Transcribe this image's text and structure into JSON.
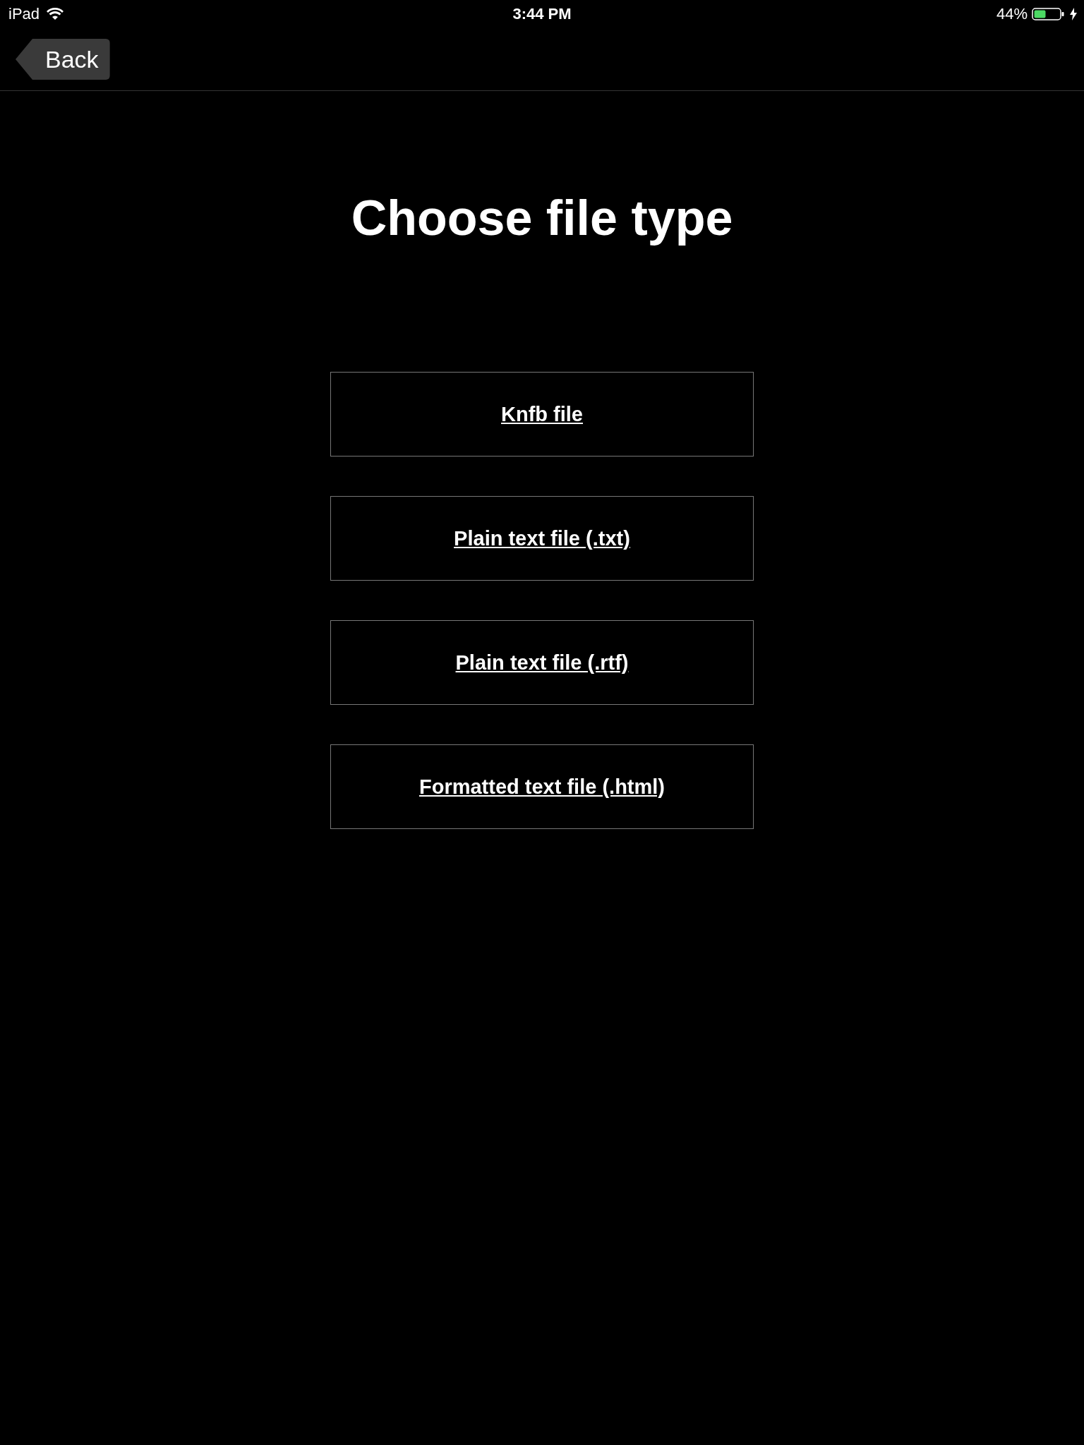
{
  "status_bar": {
    "device": "iPad",
    "time": "3:44 PM",
    "battery": "44%"
  },
  "nav": {
    "back": "Back"
  },
  "title": "Choose file type",
  "options": [
    {
      "label": "Knfb file"
    },
    {
      "label": "Plain text file (.txt)"
    },
    {
      "label": "Plain text file (.rtf)"
    },
    {
      "label": "Formatted text file (.html)"
    }
  ]
}
